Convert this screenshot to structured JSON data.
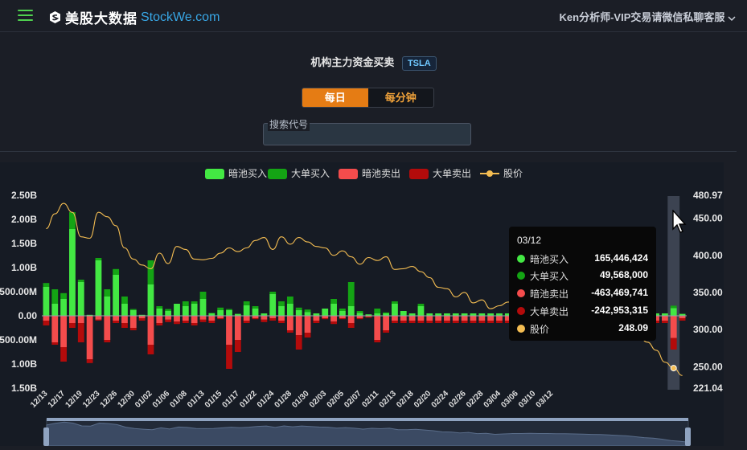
{
  "header": {
    "brand_cn": "美股大数据",
    "brand_en": "StockWe.com",
    "user_text": "Ken分析师-VIP交易请微信私聊客服"
  },
  "page": {
    "title": "机构主力资金买卖",
    "ticker": "TSLA",
    "tabs": [
      {
        "label": "每日",
        "active": true
      },
      {
        "label": "每分钟",
        "active": false
      }
    ],
    "search_label": "搜索代号"
  },
  "colors": {
    "dark_pool_buy": "#43e843",
    "block_buy": "#14a414",
    "dark_pool_sell": "#f44c4c",
    "block_sell": "#b30b0b",
    "price": "#f4bd52",
    "accent": "#e57c14"
  },
  "chart_data": {
    "type": "bar",
    "legend": [
      "暗池买入",
      "大单买入",
      "暗池卖出",
      "大单卖出",
      "股价"
    ],
    "y_left_ticks": [
      "2.50B",
      "2.00B",
      "1.50B",
      "1.00B",
      "500.00M",
      "0.00",
      "500.00M",
      "1.00B",
      "1.50B"
    ],
    "y_left_range_billions": [
      -1.5,
      2.5
    ],
    "y_right_ticks": [
      "480.97",
      "450.00",
      "400.00",
      "350.00",
      "300.00",
      "250.00",
      "221.04"
    ],
    "y_right_range": [
      221.04,
      480.97
    ],
    "x_tick_labels": [
      "12/13",
      "12/17",
      "12/19",
      "12/23",
      "12/26",
      "12/30",
      "01/02",
      "01/06",
      "01/08",
      "01/13",
      "01/15",
      "01/17",
      "01/22",
      "01/24",
      "01/28",
      "01/30",
      "02/03",
      "02/05",
      "02/07",
      "02/11",
      "02/13",
      "02/18",
      "02/20",
      "02/24",
      "02/26",
      "02/28",
      "03/04",
      "03/06",
      "03/10",
      "03/12"
    ],
    "x_tick_every": 2,
    "series": [
      {
        "name": "暗池买入",
        "values": [
          0.6,
          0.25,
          0.35,
          1.8,
          0.7,
          0.02,
          1.15,
          0.4,
          0.85,
          0.25,
          0.12,
          0.02,
          0.65,
          0.15,
          0.1,
          0.25,
          0.2,
          0.25,
          0.35,
          0.05,
          0.12,
          0.12,
          0.04,
          0.22,
          0.15,
          0.05,
          0.45,
          0.2,
          0.25,
          0.12,
          0.08,
          0.05,
          0.15,
          0.25,
          0.1,
          0.2,
          0.06,
          0.03,
          0.05,
          0.05,
          0.25,
          0.1,
          0.05,
          0.2,
          0.05,
          0.05,
          0.05,
          0.05,
          0.05,
          0.05,
          0.05,
          0.05,
          0.05,
          0.05,
          0.05,
          0.05,
          0.05,
          0.05,
          0.05,
          0.05,
          0.05,
          0.05,
          0.05,
          0.05,
          0.05,
          0.05,
          0.05,
          0.05,
          0.05,
          0.05,
          0.05,
          0.05,
          0.16,
          0.04
        ]
      },
      {
        "name": "大单买入",
        "values": [
          0.08,
          0.3,
          0.12,
          0.35,
          0.05,
          0.0,
          0.05,
          0.15,
          0.12,
          0.15,
          0.02,
          0.0,
          0.5,
          0.05,
          0.04,
          0.0,
          0.1,
          0.05,
          0.15,
          0.01,
          0.05,
          0.02,
          0.0,
          0.08,
          0.05,
          0.0,
          0.05,
          0.1,
          0.15,
          0.05,
          0.05,
          0.0,
          0.0,
          0.1,
          0.05,
          0.5,
          0.04,
          0.0,
          0.1,
          0.02,
          0.05,
          0.0,
          0.0,
          0.05,
          0.0,
          0.0,
          0.0,
          0.0,
          0.0,
          0.0,
          0.0,
          0.0,
          0.0,
          0.0,
          0.0,
          0.0,
          0.0,
          0.0,
          0.0,
          0.0,
          0.0,
          0.0,
          0.0,
          0.0,
          0.0,
          0.0,
          0.0,
          0.0,
          0.0,
          0.0,
          0.0,
          0.0,
          0.05,
          0.0
        ]
      },
      {
        "name": "暗池卖出",
        "values": [
          -0.1,
          -0.55,
          -0.65,
          -0.15,
          -0.15,
          -0.9,
          -0.08,
          -0.5,
          -0.1,
          -0.15,
          -0.25,
          -0.05,
          -0.6,
          -0.15,
          -0.08,
          -0.12,
          -0.1,
          -0.15,
          -0.08,
          -0.1,
          -0.05,
          -0.6,
          -0.5,
          -0.1,
          -0.05,
          -0.08,
          -0.05,
          -0.1,
          -0.3,
          -0.4,
          -0.35,
          -0.1,
          -0.05,
          -0.12,
          -0.05,
          -0.15,
          -0.05,
          -0.02,
          -0.5,
          -0.3,
          -0.1,
          -0.1,
          -0.1,
          -0.1,
          -0.1,
          -0.1,
          -0.1,
          -0.1,
          -0.1,
          -0.1,
          -0.1,
          -0.1,
          -0.1,
          -0.1,
          -0.1,
          -0.1,
          -0.1,
          -0.1,
          -0.1,
          -0.1,
          -0.1,
          -0.1,
          -0.1,
          -0.1,
          -0.1,
          -0.1,
          -0.1,
          -0.1,
          -0.1,
          -0.1,
          -0.1,
          -0.1,
          -0.46,
          -0.05
        ]
      },
      {
        "name": "大单卖出",
        "values": [
          -0.1,
          -0.05,
          -0.3,
          -0.1,
          -0.4,
          -0.08,
          -0.02,
          -0.05,
          -0.05,
          -0.1,
          -0.05,
          -0.05,
          -0.2,
          -0.05,
          -0.05,
          -0.05,
          -0.05,
          -0.05,
          -0.05,
          -0.05,
          -0.02,
          -0.5,
          -0.25,
          -0.05,
          -0.02,
          -0.05,
          -0.05,
          -0.05,
          -0.05,
          -0.3,
          -0.1,
          -0.05,
          -0.02,
          -0.05,
          -0.02,
          -0.1,
          -0.02,
          -0.02,
          -0.05,
          -0.05,
          -0.05,
          -0.05,
          -0.05,
          -0.05,
          -0.05,
          -0.05,
          -0.05,
          -0.05,
          -0.05,
          -0.05,
          -0.05,
          -0.05,
          -0.05,
          -0.05,
          -0.05,
          -0.05,
          -0.05,
          -0.05,
          -0.05,
          -0.05,
          -0.05,
          -0.05,
          -0.05,
          -0.05,
          -0.05,
          -0.05,
          -0.05,
          -0.05,
          -0.05,
          -0.05,
          -0.05,
          -0.05,
          -0.24,
          -0.05
        ]
      },
      {
        "name": "股价",
        "values": [
          436,
          456,
          470,
          458,
          425,
          423,
          458,
          452,
          440,
          410,
          395,
          387,
          382,
          403,
          389,
          412,
          408,
          395,
          394,
          396,
          403,
          410,
          405,
          410,
          420,
          424,
          408,
          425,
          415,
          424,
          418,
          412,
          410,
          400,
          406,
          398,
          388,
          397,
          393,
          398,
          381,
          382,
          385,
          378,
          370,
          357,
          355,
          344,
          350,
          336,
          340,
          328,
          332,
          337,
          337,
          339,
          337,
          337,
          335,
          334,
          332,
          330,
          327,
          325,
          320,
          315,
          310,
          300,
          290,
          283,
          272,
          256,
          248,
          238
        ]
      }
    ]
  },
  "tooltip": {
    "date": "03/12",
    "rows": [
      {
        "name": "暗池买入",
        "value": "165,446,424"
      },
      {
        "name": "大单买入",
        "value": "49,568,000"
      },
      {
        "name": "暗池卖出",
        "value": "-463,469,741"
      },
      {
        "name": "大单卖出",
        "value": "-242,953,315"
      },
      {
        "name": "股价",
        "value": "248.09"
      }
    ]
  }
}
